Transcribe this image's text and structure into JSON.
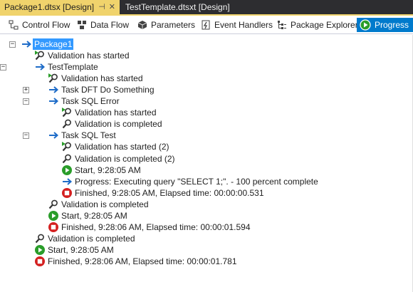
{
  "document_tabs": [
    {
      "label": "Package1.dtsx [Design]",
      "pin": "⊣",
      "close": "✕",
      "active": true
    },
    {
      "label": "TestTemplate.dtsxt [Design]",
      "active": false
    }
  ],
  "toolbar": {
    "items": [
      {
        "label": "Control Flow",
        "icon": "control-flow-icon"
      },
      {
        "label": "Data Flow",
        "icon": "data-flow-icon"
      },
      {
        "label": "Parameters",
        "icon": "parameters-icon"
      },
      {
        "label": "Event Handlers",
        "icon": "event-handlers-icon"
      },
      {
        "label": "Package Explorer",
        "icon": "package-explorer-icon"
      },
      {
        "label": "Progress",
        "icon": "progress-icon",
        "active": true
      }
    ]
  },
  "colors": {
    "accent": "#007acc",
    "tab_active": "#f0d36c",
    "tab_strip": "#2d2d30",
    "arrow_blue": "#1e6cc8",
    "start_green": "#2a9d2a",
    "stop_red": "#d42020"
  },
  "progress_tree": [
    {
      "level": 0,
      "expander": "−",
      "icon": "arrow-icon",
      "text": "Package1",
      "selected": true
    },
    {
      "level": 1,
      "icon": "validation-started-icon",
      "text": "Validation has started"
    },
    {
      "level": 1,
      "expander": "−",
      "icon": "arrow-icon",
      "text": "TestTemplate"
    },
    {
      "level": 2,
      "icon": "validation-started-icon",
      "text": "Validation has started"
    },
    {
      "level": 2,
      "expander": "+",
      "icon": "arrow-icon",
      "text": "Task DFT Do Something"
    },
    {
      "level": 2,
      "expander": "−",
      "icon": "arrow-icon",
      "text": "Task SQL Error"
    },
    {
      "level": 3,
      "icon": "validation-started-icon",
      "text": "Validation has started"
    },
    {
      "level": 3,
      "icon": "validation-completed-icon",
      "text": "Validation is completed"
    },
    {
      "level": 2,
      "expander": "−",
      "icon": "arrow-icon",
      "text": "Task SQL Test"
    },
    {
      "level": 3,
      "icon": "validation-started-icon",
      "text": "Validation has started (2)"
    },
    {
      "level": 3,
      "icon": "validation-completed-icon",
      "text": "Validation is completed (2)"
    },
    {
      "level": 3,
      "icon": "start-icon",
      "text": "Start, 9:28:05 AM"
    },
    {
      "level": 3,
      "icon": "arrow-icon",
      "text": "Progress: Executing query \"SELECT 1;\". - 100 percent complete"
    },
    {
      "level": 3,
      "icon": "finished-icon",
      "text": "Finished, 9:28:05 AM, Elapsed time: 00:00:00.531"
    },
    {
      "level": 2,
      "icon": "validation-completed-icon",
      "text": "Validation is completed"
    },
    {
      "level": 2,
      "icon": "start-icon",
      "text": "Start, 9:28:05 AM"
    },
    {
      "level": 2,
      "icon": "finished-icon",
      "text": "Finished, 9:28:06 AM, Elapsed time: 00:00:01.594"
    },
    {
      "level": 1,
      "icon": "validation-completed-icon",
      "text": "Validation is completed"
    },
    {
      "level": 1,
      "icon": "start-icon",
      "text": "Start, 9:28:05 AM"
    },
    {
      "level": 1,
      "icon": "finished-icon",
      "text": "Finished, 9:28:06 AM, Elapsed time: 00:00:01.781"
    }
  ]
}
